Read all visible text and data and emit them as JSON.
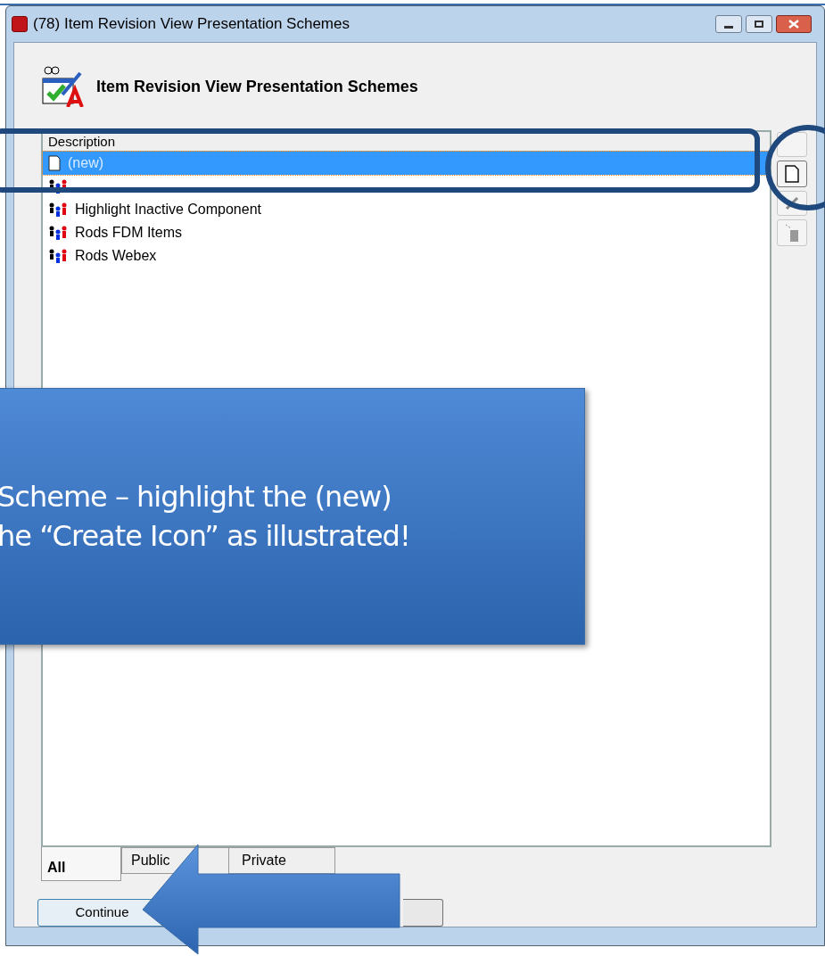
{
  "window": {
    "title": "(78) Item Revision View Presentation Schemes"
  },
  "header": {
    "title": "Item Revision View Presentation Schemes"
  },
  "list": {
    "column": "Description",
    "rows": [
      {
        "kind": "new",
        "label": "(new)",
        "selected": true
      },
      {
        "kind": "scheme",
        "selected": false
      },
      {
        "kind": "scheme",
        "label": "Highlight Inactive Component",
        "selected": false
      },
      {
        "kind": "scheme",
        "label": "Rods FDM Items",
        "selected": false
      },
      {
        "kind": "scheme",
        "label": "Rods Webex",
        "selected": false
      }
    ]
  },
  "tabs": [
    {
      "label": "All",
      "selected": true
    },
    {
      "label": "Public",
      "selected": false
    },
    {
      "label": "Private",
      "selected": false
    }
  ],
  "buttons": [
    {
      "label": "Continue"
    }
  ],
  "callout": {
    "lines": [
      "Scheme – highlight the (new)",
      "he “Create Icon” as illustrated!"
    ]
  }
}
